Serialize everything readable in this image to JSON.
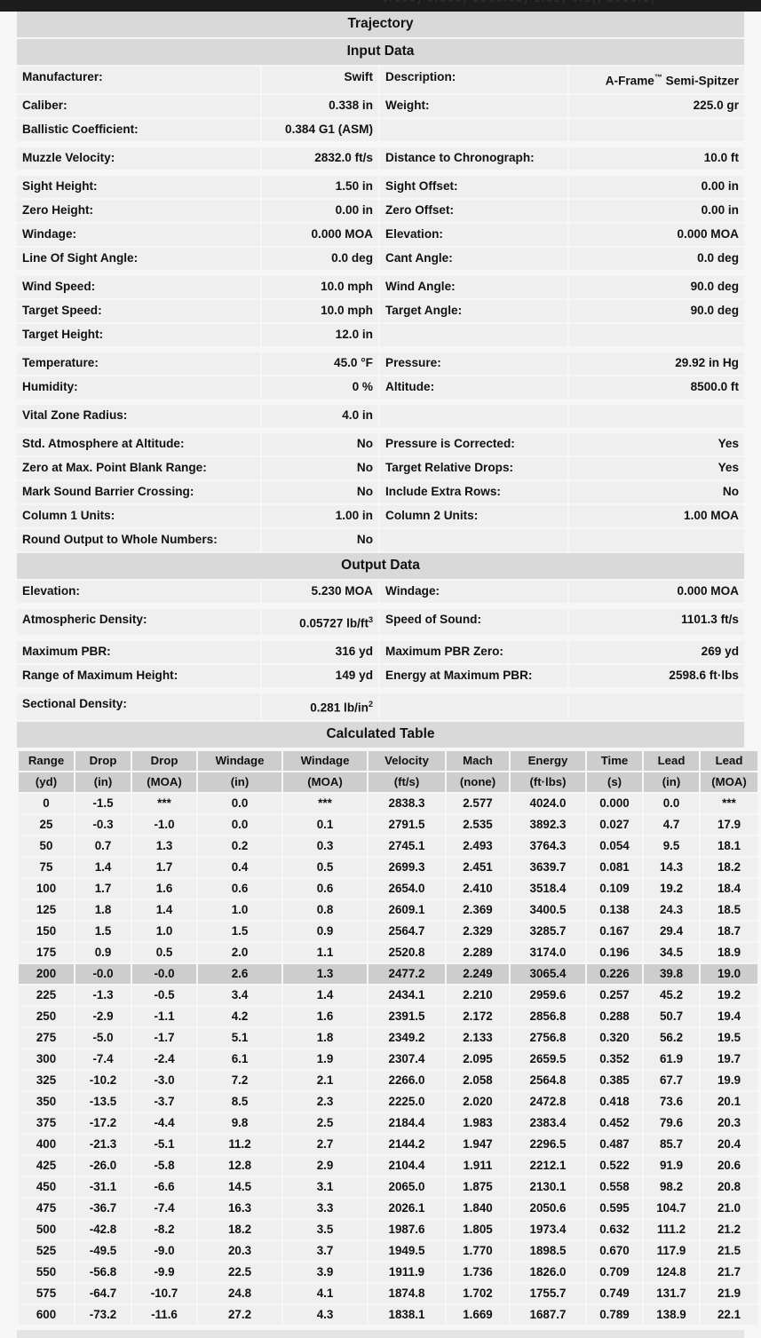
{
  "document": {
    "title": "Trajectory",
    "sections": {
      "input": "Input Data",
      "output": "Output Data",
      "calculated": "Calculated Table"
    }
  },
  "input_data": {
    "groups": [
      {
        "rows": [
          {
            "label": "Manufacturer:",
            "value": "Swift",
            "label2": "Description:",
            "value2": "A-Frame™ Semi-Spitzer"
          },
          {
            "label": "Caliber:",
            "value": "0.338 in",
            "label2": "Weight:",
            "value2": "225.0 gr"
          },
          {
            "label": "Ballistic Coefficient:",
            "value": "0.384 G1 (ASM)",
            "label2": "",
            "value2": ""
          }
        ]
      },
      {
        "rows": [
          {
            "label": "Muzzle Velocity:",
            "value": "2832.0 ft/s",
            "label2": "Distance to Chronograph:",
            "value2": "10.0 ft"
          }
        ]
      },
      {
        "rows": [
          {
            "label": "Sight Height:",
            "value": "1.50 in",
            "label2": "Sight Offset:",
            "value2": "0.00 in"
          },
          {
            "label": "Zero Height:",
            "value": "0.00 in",
            "label2": "Zero Offset:",
            "value2": "0.00 in"
          },
          {
            "label": "Windage:",
            "value": "0.000 MOA",
            "label2": "Elevation:",
            "value2": "0.000 MOA"
          },
          {
            "label": "Line Of Sight Angle:",
            "value": "0.0 deg",
            "label2": "Cant Angle:",
            "value2": "0.0 deg"
          }
        ]
      },
      {
        "rows": [
          {
            "label": "Wind Speed:",
            "value": "10.0 mph",
            "label2": "Wind Angle:",
            "value2": "90.0 deg"
          },
          {
            "label": "Target Speed:",
            "value": "10.0 mph",
            "label2": "Target Angle:",
            "value2": "90.0 deg"
          },
          {
            "label": "Target Height:",
            "value": "12.0 in",
            "label2": "",
            "value2": ""
          }
        ]
      },
      {
        "rows": [
          {
            "label": "Temperature:",
            "value": "45.0 °F",
            "label2": "Pressure:",
            "value2": "29.92 in Hg"
          },
          {
            "label": "Humidity:",
            "value": "0 %",
            "label2": "Altitude:",
            "value2": "8500.0 ft"
          }
        ]
      },
      {
        "rows": [
          {
            "label": "Vital Zone Radius:",
            "value": "4.0 in",
            "label2": "",
            "value2": ""
          }
        ]
      },
      {
        "rows": [
          {
            "label": "Std. Atmosphere at Altitude:",
            "value": "No",
            "label2": "Pressure is Corrected:",
            "value2": "Yes"
          },
          {
            "label": "Zero at Max. Point Blank Range:",
            "value": "No",
            "label2": "Target Relative Drops:",
            "value2": "Yes"
          },
          {
            "label": "Mark Sound Barrier Crossing:",
            "value": "No",
            "label2": "Include Extra Rows:",
            "value2": "No"
          },
          {
            "label": "Column 1 Units:",
            "value": "1.00 in",
            "label2": "Column 2 Units:",
            "value2": "1.00 MOA"
          },
          {
            "label": "Round Output to Whole Numbers:",
            "value": "No",
            "label2": "",
            "value2": ""
          }
        ]
      }
    ]
  },
  "output_data": {
    "groups": [
      {
        "rows": [
          {
            "label": "Elevation:",
            "value": "5.230 MOA",
            "label2": "Windage:",
            "value2": "0.000 MOA"
          }
        ]
      },
      {
        "rows": [
          {
            "label": "Atmospheric Density:",
            "value": "0.05727 lb/ft³",
            "label2": "Speed of Sound:",
            "value2": "1101.3 ft/s"
          }
        ]
      },
      {
        "rows": [
          {
            "label": "Maximum PBR:",
            "value": "316 yd",
            "label2": "Maximum PBR Zero:",
            "value2": "269 yd"
          },
          {
            "label": "Range of Maximum Height:",
            "value": "149 yd",
            "label2": "Energy at Maximum PBR:",
            "value2": "2598.6 ft·lbs"
          }
        ]
      },
      {
        "rows": [
          {
            "label": "Sectional Density:",
            "value": "0.281 lb/in²",
            "label2": "",
            "value2": ""
          }
        ]
      }
    ]
  },
  "chart_data": {
    "type": "table",
    "title": "Calculated Table",
    "columns": [
      {
        "name": "Range",
        "unit": "(yd)"
      },
      {
        "name": "Drop",
        "unit": "(in)"
      },
      {
        "name": "Drop",
        "unit": "(MOA)"
      },
      {
        "name": "Windage",
        "unit": "(in)"
      },
      {
        "name": "Windage",
        "unit": "(MOA)"
      },
      {
        "name": "Velocity",
        "unit": "(ft/s)"
      },
      {
        "name": "Mach",
        "unit": "(none)"
      },
      {
        "name": "Energy",
        "unit": "(ft·lbs)"
      },
      {
        "name": "Time",
        "unit": "(s)"
      },
      {
        "name": "Lead",
        "unit": "(in)"
      },
      {
        "name": "Lead",
        "unit": "(MOA)"
      }
    ],
    "highlighted_row_index": 8,
    "rows": [
      [
        "0",
        "-1.5",
        "***",
        "0.0",
        "***",
        "2838.3",
        "2.577",
        "4024.0",
        "0.000",
        "0.0",
        "***"
      ],
      [
        "25",
        "-0.3",
        "-1.0",
        "0.0",
        "0.1",
        "2791.5",
        "2.535",
        "3892.3",
        "0.027",
        "4.7",
        "17.9"
      ],
      [
        "50",
        "0.7",
        "1.3",
        "0.2",
        "0.3",
        "2745.1",
        "2.493",
        "3764.3",
        "0.054",
        "9.5",
        "18.1"
      ],
      [
        "75",
        "1.4",
        "1.7",
        "0.4",
        "0.5",
        "2699.3",
        "2.451",
        "3639.7",
        "0.081",
        "14.3",
        "18.2"
      ],
      [
        "100",
        "1.7",
        "1.6",
        "0.6",
        "0.6",
        "2654.0",
        "2.410",
        "3518.4",
        "0.109",
        "19.2",
        "18.4"
      ],
      [
        "125",
        "1.8",
        "1.4",
        "1.0",
        "0.8",
        "2609.1",
        "2.369",
        "3400.5",
        "0.138",
        "24.3",
        "18.5"
      ],
      [
        "150",
        "1.5",
        "1.0",
        "1.5",
        "0.9",
        "2564.7",
        "2.329",
        "3285.7",
        "0.167",
        "29.4",
        "18.7"
      ],
      [
        "175",
        "0.9",
        "0.5",
        "2.0",
        "1.1",
        "2520.8",
        "2.289",
        "3174.0",
        "0.196",
        "34.5",
        "18.9"
      ],
      [
        "200",
        "-0.0",
        "-0.0",
        "2.6",
        "1.3",
        "2477.2",
        "2.249",
        "3065.4",
        "0.226",
        "39.8",
        "19.0"
      ],
      [
        "225",
        "-1.3",
        "-0.5",
        "3.4",
        "1.4",
        "2434.1",
        "2.210",
        "2959.6",
        "0.257",
        "45.2",
        "19.2"
      ],
      [
        "250",
        "-2.9",
        "-1.1",
        "4.2",
        "1.6",
        "2391.5",
        "2.172",
        "2856.8",
        "0.288",
        "50.7",
        "19.4"
      ],
      [
        "275",
        "-5.0",
        "-1.7",
        "5.1",
        "1.8",
        "2349.2",
        "2.133",
        "2756.8",
        "0.320",
        "56.2",
        "19.5"
      ],
      [
        "300",
        "-7.4",
        "-2.4",
        "6.1",
        "1.9",
        "2307.4",
        "2.095",
        "2659.5",
        "0.352",
        "61.9",
        "19.7"
      ],
      [
        "325",
        "-10.2",
        "-3.0",
        "7.2",
        "2.1",
        "2266.0",
        "2.058",
        "2564.8",
        "0.385",
        "67.7",
        "19.9"
      ],
      [
        "350",
        "-13.5",
        "-3.7",
        "8.5",
        "2.3",
        "2225.0",
        "2.020",
        "2472.8",
        "0.418",
        "73.6",
        "20.1"
      ],
      [
        "375",
        "-17.2",
        "-4.4",
        "9.8",
        "2.5",
        "2184.4",
        "1.983",
        "2383.4",
        "0.452",
        "79.6",
        "20.3"
      ],
      [
        "400",
        "-21.3",
        "-5.1",
        "11.2",
        "2.7",
        "2144.2",
        "1.947",
        "2296.5",
        "0.487",
        "85.7",
        "20.4"
      ],
      [
        "425",
        "-26.0",
        "-5.8",
        "12.8",
        "2.9",
        "2104.4",
        "1.911",
        "2212.1",
        "0.522",
        "91.9",
        "20.6"
      ],
      [
        "450",
        "-31.1",
        "-6.6",
        "14.5",
        "3.1",
        "2065.0",
        "1.875",
        "2130.1",
        "0.558",
        "98.2",
        "20.8"
      ],
      [
        "475",
        "-36.7",
        "-7.4",
        "16.3",
        "3.3",
        "2026.1",
        "1.840",
        "2050.6",
        "0.595",
        "104.7",
        "21.0"
      ],
      [
        "500",
        "-42.8",
        "-8.2",
        "18.2",
        "3.5",
        "1987.6",
        "1.805",
        "1973.4",
        "0.632",
        "111.2",
        "21.2"
      ],
      [
        "525",
        "-49.5",
        "-9.0",
        "20.3",
        "3.7",
        "1949.5",
        "1.770",
        "1898.5",
        "0.670",
        "117.9",
        "21.5"
      ],
      [
        "550",
        "-56.8",
        "-9.9",
        "22.5",
        "3.9",
        "1911.9",
        "1.736",
        "1826.0",
        "0.709",
        "124.8",
        "21.7"
      ],
      [
        "575",
        "-64.7",
        "-10.7",
        "24.8",
        "4.1",
        "1874.8",
        "1.702",
        "1755.7",
        "0.749",
        "131.7",
        "21.9"
      ],
      [
        "600",
        "-73.2",
        "-11.6",
        "27.2",
        "4.3",
        "1838.1",
        "1.669",
        "1687.7",
        "0.789",
        "138.9",
        "22.1"
      ]
    ],
    "xlabel": "Range (yd)",
    "ylabel": "",
    "grid": false,
    "legend": "none"
  },
  "colors": {
    "header_bg": "#d9d9d9",
    "cell_bg": "#efefef",
    "highlight_bg": "#cdcdcd",
    "page_bg": "#f6f6f6",
    "text": "#111111"
  }
}
